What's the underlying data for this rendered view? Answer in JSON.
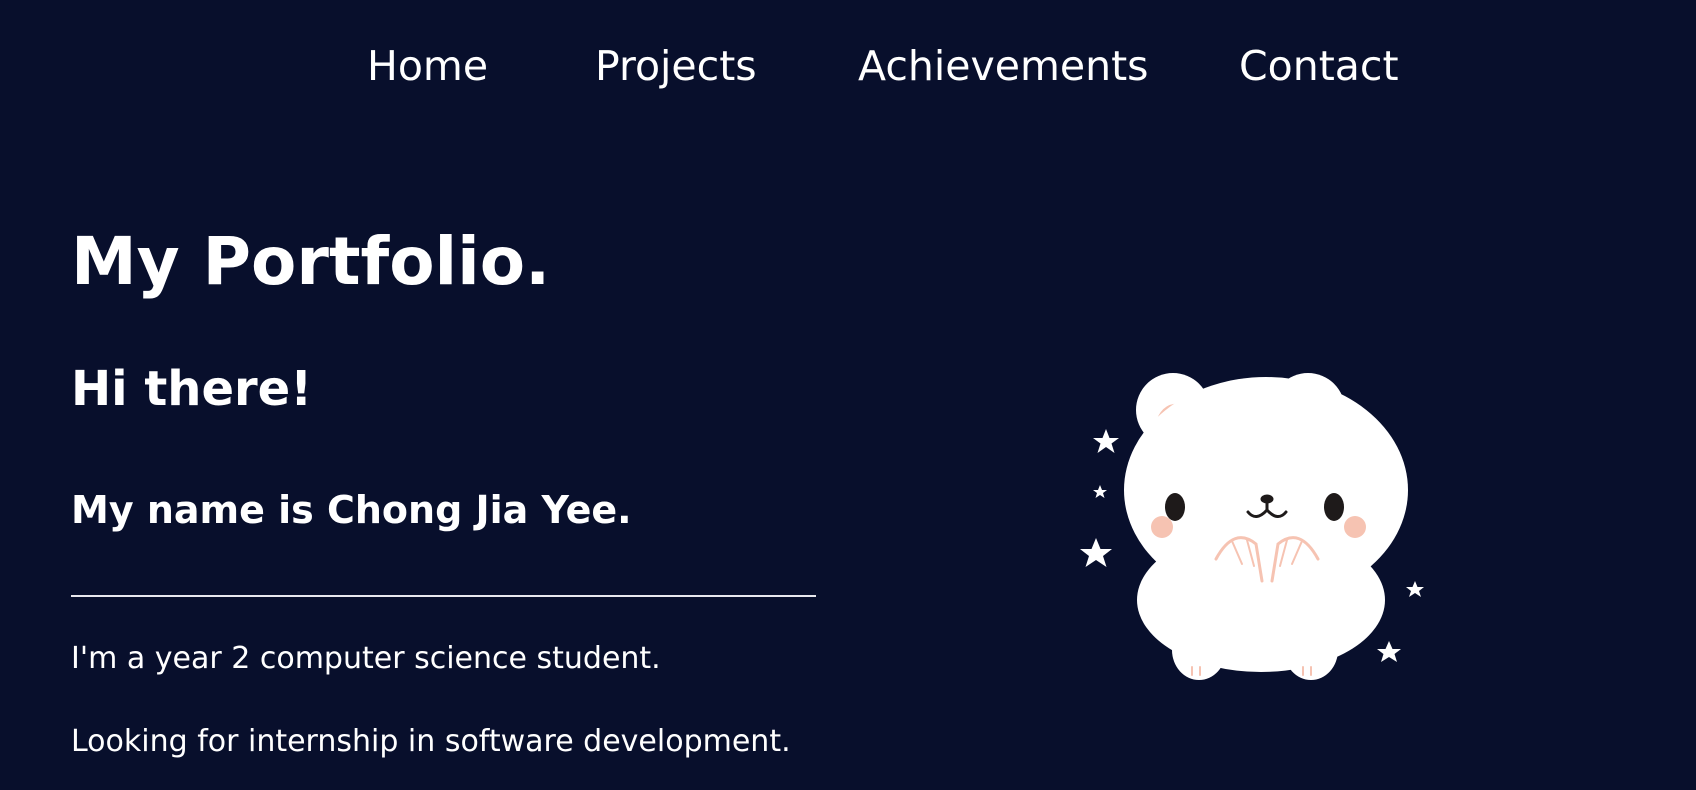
{
  "nav": {
    "items": [
      {
        "label": "Home"
      },
      {
        "label": "Projects"
      },
      {
        "label": "Achievements"
      },
      {
        "label": "Contact"
      }
    ]
  },
  "hero": {
    "title": "My Portfolio.",
    "greeting": "Hi there!",
    "name_line": "My name is Chong Jia Yee.",
    "line1": "I'm a year 2 computer science student.",
    "line2": "Looking for internship in software development."
  },
  "illustration": {
    "icon": "polar-bear-icon",
    "colors": {
      "background": "#080f2c",
      "bear": "#ffffff",
      "blush": "#f6c3b2",
      "eyes": "#1e1a1a"
    }
  }
}
